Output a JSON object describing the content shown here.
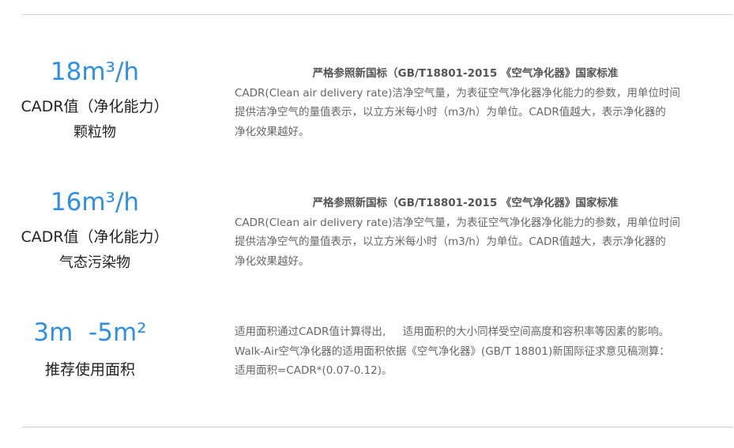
{
  "colors": {
    "accent": "#2f8fe8",
    "text_dark": "#222222",
    "text_muted": "#666666",
    "rule": "#cfcfcf"
  },
  "specs": [
    {
      "value": "18m³/h",
      "label": "CADR值（净化能力）",
      "sub": "颗粒物",
      "heading": "严格参照新国标（GB/T18801-2015 《空气净化器》国家标准",
      "lines": [
        "CADR(Clean air delivery rate)洁净空气量，为表征空气净化器净化能力的参数，用单位时间",
        "提供洁净空气的量值表示，以立方米每小时（m3/h）为单位。CADR值越大，表示净化器的",
        "净化效果越好。"
      ]
    },
    {
      "value": "16m³/h",
      "label": "CADR值（净化能力）",
      "sub": "气态污染物",
      "heading": "严格参照新国标（GB/T18801-2015 《空气净化器》国家标准",
      "lines": [
        "CADR(Clean air delivery rate)洁净空气量，为表征空气净化器净化能力的参数，用单位时间",
        "提供洁净空气的量值表示，以立方米每小时（m3/h）为单位。CADR值越大，表示净化器的",
        "净化效果越好。"
      ]
    },
    {
      "value": "3m  -5m²",
      "label": "推荐使用面积",
      "lines": [
        "适用面积通过CADR值计算得出,     适用面积的大小同样受空间高度和容积率等因素的影响。",
        "Walk-Air空气净化器的适用面积依据《空气净化器》(GB/T 18801)新国际征求意见稿测算：",
        "适用面积=CADR*(0.07-0.12)。"
      ]
    }
  ]
}
